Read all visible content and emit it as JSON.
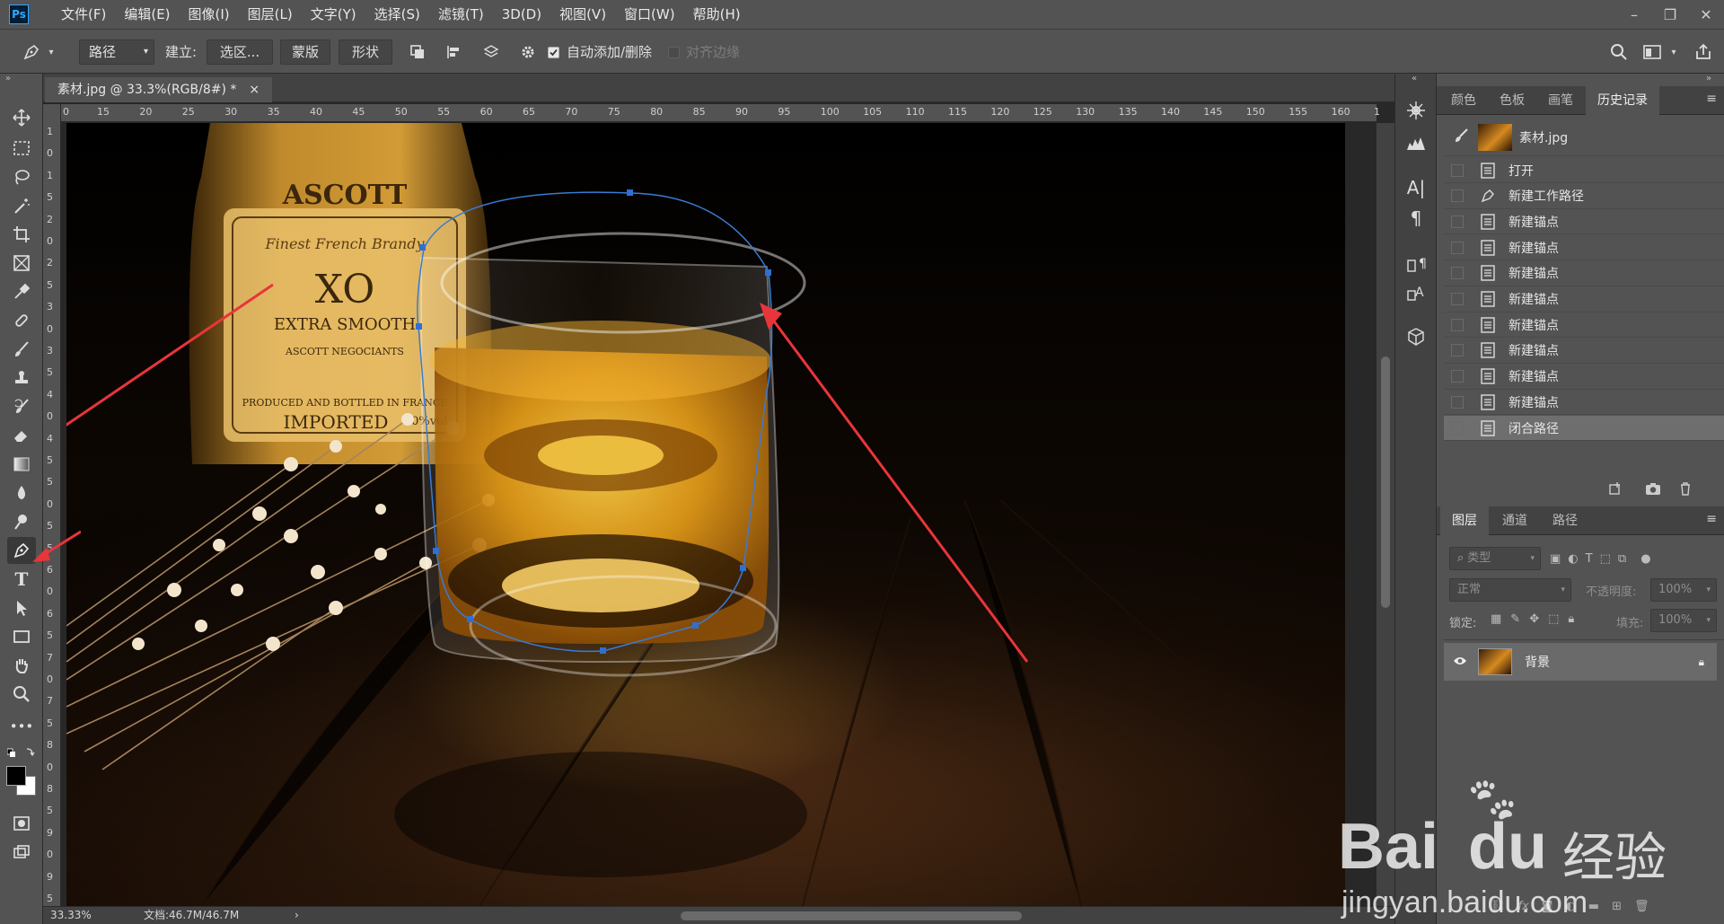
{
  "app": {
    "logo": "Ps"
  },
  "menu": [
    "文件(F)",
    "编辑(E)",
    "图像(I)",
    "图层(L)",
    "文字(Y)",
    "选择(S)",
    "滤镜(T)",
    "3D(D)",
    "视图(V)",
    "窗口(W)",
    "帮助(H)"
  ],
  "options": {
    "mode": "路径",
    "make_label": "建立:",
    "selection_btn": "选区...",
    "mask_btn": "蒙版",
    "shape_btn": "形状",
    "auto_add_delete": "自动添加/删除",
    "align_edges": "对齐边缘"
  },
  "document": {
    "tab_title": "素材.jpg @ 33.3%(RGB/8#) *",
    "close": "×"
  },
  "ruler": {
    "top": [
      "0",
      "15",
      "20",
      "25",
      "30",
      "35",
      "40",
      "45",
      "50",
      "55",
      "60",
      "65",
      "70",
      "75",
      "80",
      "85",
      "90",
      "95",
      "100",
      "105",
      "110",
      "115",
      "120",
      "125",
      "130",
      "135",
      "140",
      "145",
      "150",
      "155",
      "160",
      "1"
    ],
    "left": [
      "1",
      "0",
      "1",
      "5",
      "2",
      "0",
      "2",
      "5",
      "3",
      "0",
      "3",
      "5",
      "4",
      "0",
      "4",
      "5",
      "5",
      "0",
      "5",
      "5",
      "6",
      "0",
      "6",
      "5",
      "7",
      "0",
      "7",
      "5",
      "8",
      "0",
      "8",
      "5",
      "9",
      "0",
      "9",
      "5"
    ]
  },
  "status": {
    "zoom": "33.33%",
    "doc": "文档:46.7M/46.7M",
    "arrow": "›"
  },
  "history_panel": {
    "tabs": [
      "颜色",
      "色板",
      "画笔",
      "历史记录"
    ],
    "snapshot": "素材.jpg",
    "items": [
      "打开",
      "新建工作路径",
      "新建锚点",
      "新建锚点",
      "新建锚点",
      "新建锚点",
      "新建锚点",
      "新建锚点",
      "新建锚点",
      "新建锚点",
      "闭合路径"
    ]
  },
  "layers_panel": {
    "tabs": [
      "图层",
      "通道",
      "路径"
    ],
    "filter": "类型",
    "blend": "正常",
    "opacity_label": "不透明度:",
    "opacity": "100%",
    "lock_label": "锁定:",
    "fill_label": "填充:",
    "fill": "100%",
    "layer_name": "背景"
  },
  "image_text": {
    "label1": "ASCOTT",
    "label2": "Finest French Brandy",
    "label3": "XO",
    "label4": "EXTRA SMOOTH",
    "label5": "ASCOTT NEGOCIANTS",
    "label6": "PRODUCED AND BOTTLED IN FRANCE",
    "label7": "IMPORTED",
    "label8": "40%vol"
  },
  "watermark": {
    "brand": "Bai",
    "brand2": "du",
    "cn": "经验",
    "url": "jingyan.baidu.com"
  }
}
